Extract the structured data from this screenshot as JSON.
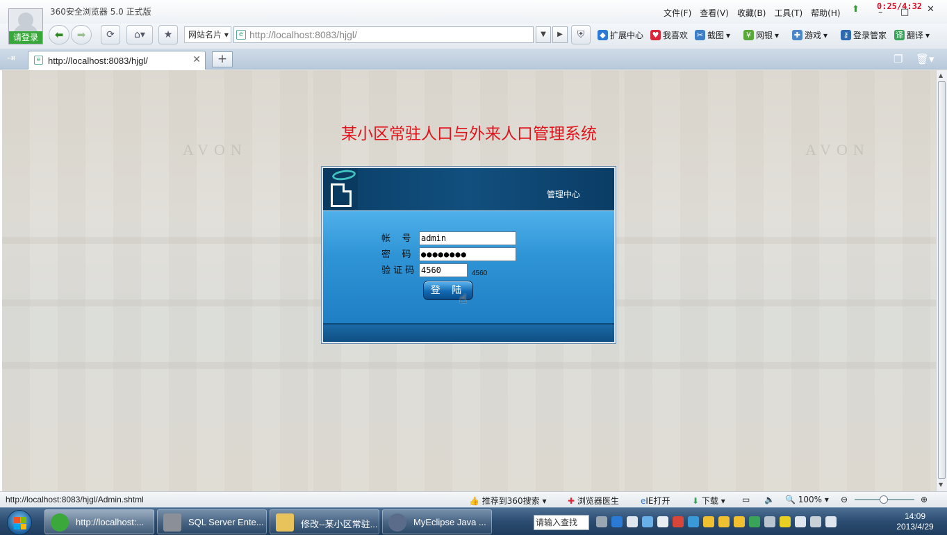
{
  "browser": {
    "app_title": "360安全浏览器 5.0 正式版",
    "login_label": "请登录",
    "menu": [
      "文件(F)",
      "查看(V)",
      "收藏(B)",
      "工具(T)",
      "帮助(H)"
    ],
    "timer": "0:25/4:32",
    "site_card": "网站名片",
    "address": "http://localhost:8083/hjgl/",
    "extensions": [
      "扩展中心",
      "我喜欢",
      "截图",
      "网银",
      "游戏",
      "登录管家",
      "翻译"
    ]
  },
  "tab": {
    "label": "http://localhost:8083/hjgl/"
  },
  "page": {
    "title": "某小区常驻人口与外来人口管理系统",
    "panel_title": "管理中心",
    "account_label": "帐    号",
    "password_label": "密    码",
    "captcha_label": "验 证 码",
    "account_value": "admin",
    "password_value": "●●●●●●●●",
    "captcha_value": "4560",
    "captcha_image_text": "4560",
    "login_button": "登 陆",
    "bg_sign": "AVON"
  },
  "statusbar": {
    "url": "http://localhost:8083/hjgl/Admin.shtml",
    "search_promo": "推荐到360搜索",
    "doctor": "浏览器医生",
    "ie_open": "IE打开",
    "download": "下载",
    "zoom": "100%"
  },
  "taskbar": {
    "tasks": [
      "http://localhost:...",
      "SQL Server Ente...",
      "修改--某小区常驻...",
      "MyEclipse Java ..."
    ],
    "search_placeholder": "请输入查找",
    "time": "14:09",
    "date": "2013/4/29"
  },
  "colors": {
    "title_red": "#e0141c",
    "panel_dark": "#0d4f80",
    "panel_blue": "#2f94d6"
  }
}
